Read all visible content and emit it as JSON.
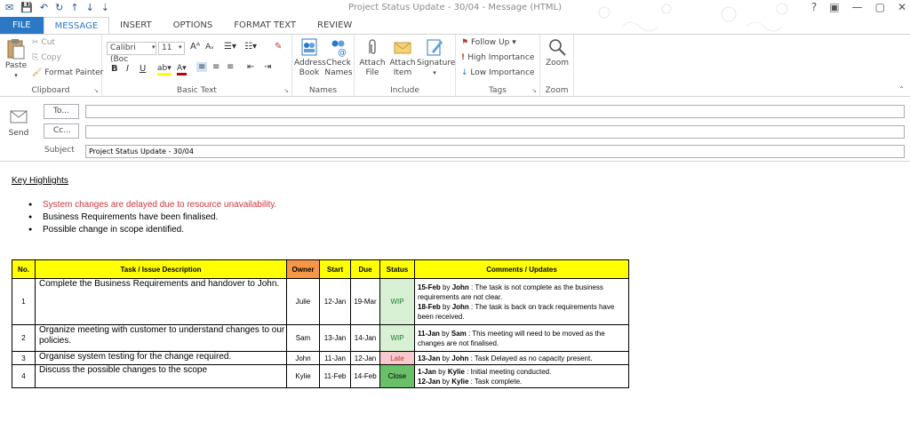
{
  "window": {
    "title": "Project Status Update - 30/04 - Message (HTML)",
    "controls": [
      "?",
      "▣",
      "—",
      "▢",
      "✕"
    ]
  },
  "tabs": [
    "FILE",
    "MESSAGE",
    "INSERT",
    "OPTIONS",
    "FORMAT TEXT",
    "REVIEW"
  ],
  "ribbon": {
    "clipboard": {
      "label": "Clipboard",
      "paste": "Paste",
      "cut": "Cut",
      "copy": "Copy",
      "format_painter": "Format Painter"
    },
    "basic_text": {
      "label": "Basic Text",
      "font": "Calibri (Boc",
      "size": "11"
    },
    "names": {
      "label": "Names",
      "address_book": "Address Book",
      "check_names": "Check Names"
    },
    "include": {
      "label": "Include",
      "attach_file": "Attach File",
      "attach_item": "Attach Item",
      "signature": "Signature"
    },
    "tags": {
      "label": "Tags",
      "follow_up": "Follow Up",
      "high": "High Importance",
      "low": "Low Importance"
    },
    "zoom": {
      "label": "Zoom",
      "zoom": "Zoom"
    }
  },
  "header": {
    "send": "Send",
    "to_label": "To...",
    "cc_label": "Cc...",
    "subject_label": "Subject",
    "subject": "Project Status Update - 30/04"
  },
  "body": {
    "heading": "Key Highlights",
    "bullets": [
      "System changes are delayed due to resource unavailability.",
      "Business Requirements have been finalised.",
      "Possible change in scope identified."
    ],
    "table": {
      "headers": [
        "No.",
        "Task / Issue Description",
        "Owner",
        "Start",
        "Due",
        "Status",
        "Comments / Updates"
      ],
      "rows": [
        {
          "no": "1",
          "desc": "Complete the Business Requirements and handover to John.",
          "owner": "Julie",
          "start": "12-Jan",
          "due": "19-Mar",
          "status": "WIP",
          "c1_date": "15-Feb",
          "c1_by": " by ",
          "c1_who": "John",
          "c1_text": " : The task is not complete as the business requirements are not clear.",
          "c2_date": "18-Feb",
          "c2_by": " by ",
          "c2_who": "John",
          "c2_text": " : The task is back on track requirements have been received."
        },
        {
          "no": "2",
          "desc": "Organize meeting with customer to understand changes to our policies.",
          "owner": "Sam",
          "start": "13-Jan",
          "due": "14-Jan",
          "status": "WIP",
          "c1_date": "11-Jan",
          "c1_by": " by ",
          "c1_who": "Sam",
          "c1_text": " : This meeting will need to be moved as the changes are not finalised."
        },
        {
          "no": "3",
          "desc": "Organise system testing for the change required.",
          "owner": "John",
          "start": "11-Jan",
          "due": "12-Jan",
          "status": "Late",
          "c1_date": "13-Jan",
          "c1_by": " by ",
          "c1_who": "John",
          "c1_text": " : Task Delayed as no capacity present."
        },
        {
          "no": "4",
          "desc": "Discuss the possible changes to the scope",
          "owner": "Kylie",
          "start": "11-Feb",
          "due": "14-Feb",
          "status": "Close",
          "c1_date": "1-Jan",
          "c1_by": " by ",
          "c1_who": "Kylie",
          "c1_text": " : Initial meeting conducted.",
          "c2_date": "12-Jan",
          "c2_by": " by ",
          "c2_who": "Kylie",
          "c2_text": " : Task complete."
        }
      ]
    }
  },
  "colors": {
    "file_tab": "#2b78c5",
    "header_yellow": "#ffff00",
    "header_orange": "#f79646",
    "wip": "#d8f0d3",
    "late": "#f6c9cf",
    "close": "#6abf69",
    "red_text": "#d13438"
  }
}
